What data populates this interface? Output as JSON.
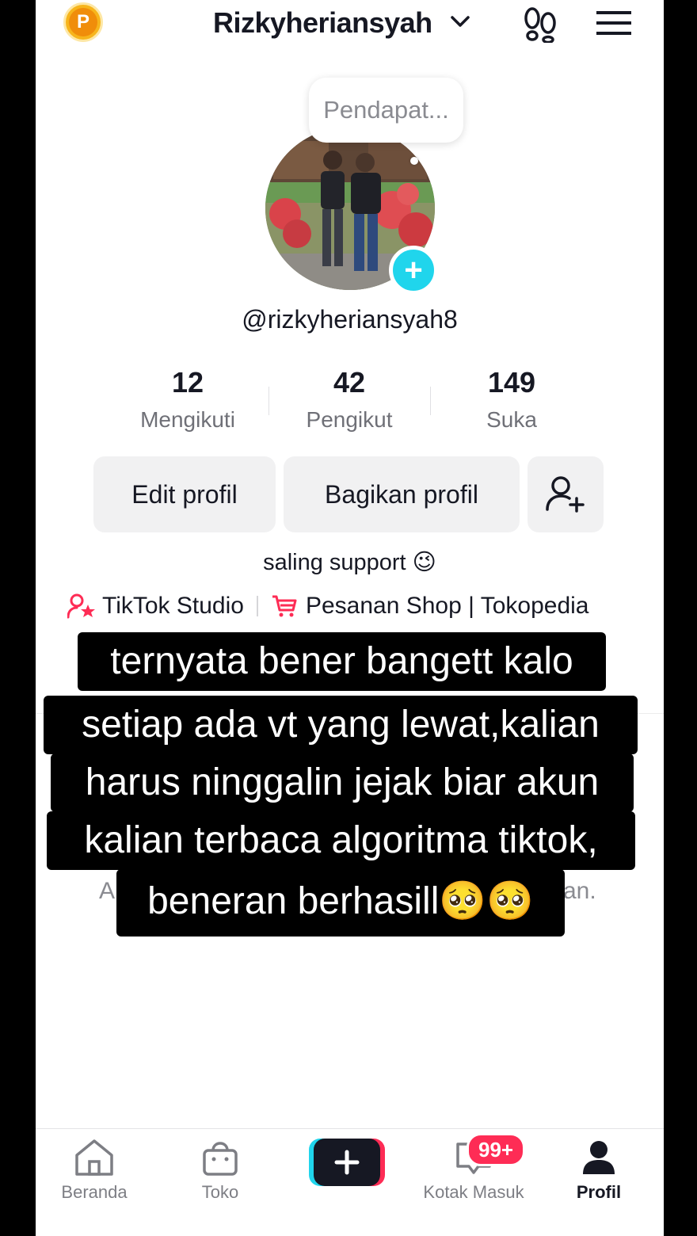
{
  "header": {
    "coin_letter": "P",
    "title": "Rizkyheriansyah",
    "icons": [
      "coin-icon",
      "chevron-down-icon",
      "footprints-icon",
      "menu-icon"
    ]
  },
  "profile": {
    "note": "Pendapat...",
    "handle": "@rizkyheriansyah8",
    "stats": [
      {
        "value": "12",
        "label": "Mengikuti"
      },
      {
        "value": "42",
        "label": "Pengikut"
      },
      {
        "value": "149",
        "label": "Suka"
      }
    ],
    "buttons": {
      "edit": "Edit profil",
      "share": "Bagikan profil"
    },
    "bio": "saling support 😉",
    "links": {
      "studio": "TikTok Studio",
      "shop": "Pesanan Shop | Tokopedia"
    },
    "partial_left": "A",
    "partial_right": "an."
  },
  "caption": {
    "lines": [
      "ternyata bener bangett kalo",
      "setiap ada vt yang lewat,kalian",
      "harus ninggalin jejak biar akun",
      "kalian terbaca algoritma tiktok,",
      "beneran berhasill🥺🥺"
    ]
  },
  "nav": {
    "items": [
      {
        "label": "Beranda"
      },
      {
        "label": "Toko"
      },
      {
        "label": "Kotak Masuk"
      },
      {
        "label": "Profil"
      }
    ],
    "badge": "99+"
  },
  "colors": {
    "accent_cyan": "#20d5ec",
    "accent_red": "#fe2c55",
    "text": "#161823",
    "muted": "#8a8b91"
  }
}
